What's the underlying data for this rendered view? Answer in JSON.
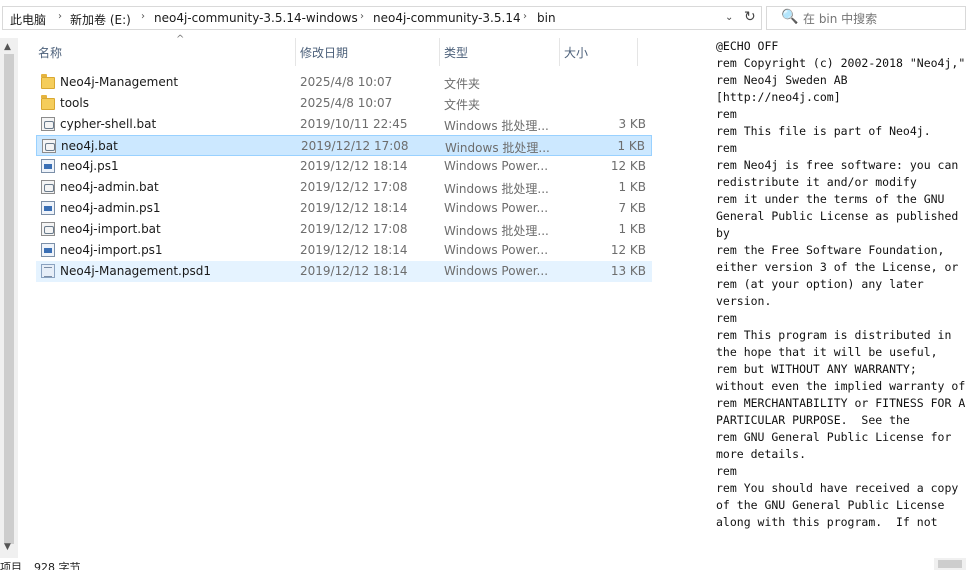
{
  "address": {
    "crumbs": [
      "此电脑",
      "新加卷 (E:)",
      "neo4j-community-3.5.14-windows",
      "neo4j-community-3.5.14",
      "bin"
    ],
    "separator": "›",
    "dropdown": "⌄",
    "refresh": "↻"
  },
  "search": {
    "placeholder": "在 bin 中搜索",
    "icon": "🔍"
  },
  "columns": {
    "name": "名称",
    "date": "修改日期",
    "type": "类型",
    "size": "大小",
    "sort_indicator": "^"
  },
  "files": [
    {
      "name": "Neo4j-Management",
      "date": "2025/4/8 10:07",
      "type": "文件夹",
      "size": "",
      "icon": "folder"
    },
    {
      "name": "tools",
      "date": "2025/4/8 10:07",
      "type": "文件夹",
      "size": "",
      "icon": "folder"
    },
    {
      "name": "cypher-shell.bat",
      "date": "2019/10/11 22:45",
      "type": "Windows 批处理...",
      "size": "3 KB",
      "icon": "bat"
    },
    {
      "name": "neo4j.bat",
      "date": "2019/12/12 17:08",
      "type": "Windows 批处理...",
      "size": "1 KB",
      "icon": "bat",
      "selected": true
    },
    {
      "name": "neo4j.ps1",
      "date": "2019/12/12 18:14",
      "type": "Windows Power...",
      "size": "12 KB",
      "icon": "ps1"
    },
    {
      "name": "neo4j-admin.bat",
      "date": "2019/12/12 17:08",
      "type": "Windows 批处理...",
      "size": "1 KB",
      "icon": "bat"
    },
    {
      "name": "neo4j-admin.ps1",
      "date": "2019/12/12 18:14",
      "type": "Windows Power...",
      "size": "7 KB",
      "icon": "ps1"
    },
    {
      "name": "neo4j-import.bat",
      "date": "2019/12/12 17:08",
      "type": "Windows 批处理...",
      "size": "1 KB",
      "icon": "bat"
    },
    {
      "name": "neo4j-import.ps1",
      "date": "2019/12/12 18:14",
      "type": "Windows Power...",
      "size": "12 KB",
      "icon": "ps1"
    },
    {
      "name": "Neo4j-Management.psd1",
      "date": "2019/12/12 18:14",
      "type": "Windows Power...",
      "size": "13 KB",
      "icon": "psd1",
      "hovered": true
    }
  ],
  "status": {
    "items": "项目",
    "size": "928 字节"
  },
  "preview": {
    "text": "@ECHO OFF\nrem Copyright (c) 2002-2018 \"Neo4j,\"\nrem Neo4j Sweden AB [http://neo4j.com]\nrem\nrem This file is part of Neo4j.\nrem\nrem Neo4j is free software: you can redistribute it and/or modify\nrem it under the terms of the GNU General Public License as published by\nrem the Free Software Foundation, either version 3 of the License, or\nrem (at your option) any later version.\nrem\nrem This program is distributed in the hope that it will be useful,\nrem but WITHOUT ANY WARRANTY; without even the implied warranty of\nrem MERCHANTABILITY or FITNESS FOR A PARTICULAR PURPOSE.  See the\nrem GNU General Public License for more details.\nrem\nrem You should have received a copy of the GNU General Public License\nalong with this program.  If not"
  },
  "colors": {
    "selected_bg": "#cce8ff",
    "selected_border": "#99d1ff",
    "hover_bg": "#e5f3ff",
    "header_text": "#4c607a"
  }
}
